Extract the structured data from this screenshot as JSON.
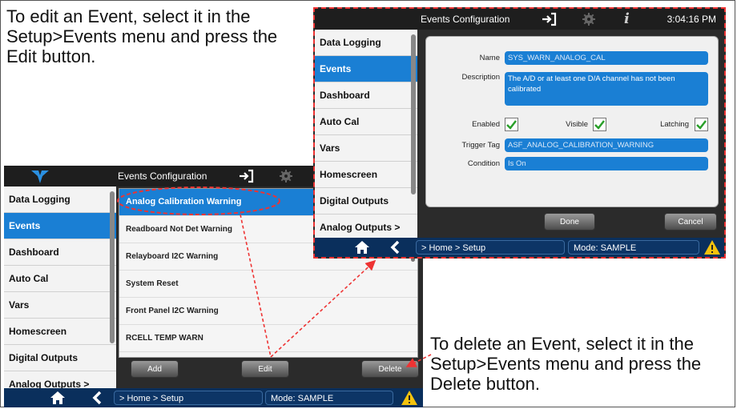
{
  "notes": {
    "edit": "To edit an Event, select it in the Setup>Events menu and press the Edit button.",
    "delete": "To delete an Event, select it in the Setup>Events menu and press the Delete button."
  },
  "list_screen": {
    "title": "Events Configuration",
    "sidebar": [
      "Data Logging",
      "Events",
      "Dashboard",
      "Auto Cal",
      "Vars",
      "Homescreen",
      "Digital Outputs",
      "Analog Outputs >"
    ],
    "active_sidebar": "Events",
    "events": [
      "Analog Calibration Warning",
      "Readboard Not Det Warning",
      "Relayboard I2C Warning",
      "System Reset",
      "Front Panel I2C Warning",
      "RCELL TEMP WARN"
    ],
    "selected_event": "Analog Calibration Warning",
    "buttons": {
      "add": "Add",
      "edit": "Edit",
      "delete": "Delete"
    },
    "breadcrumb": "> Home > Setup",
    "mode": "Mode: SAMPLE"
  },
  "detail_screen": {
    "title": "Events Configuration",
    "time": "3:04:16 PM",
    "sidebar": [
      "Data Logging",
      "Events",
      "Dashboard",
      "Auto Cal",
      "Vars",
      "Homescreen",
      "Digital Outputs",
      "Analog Outputs >"
    ],
    "active_sidebar": "Events",
    "labels": {
      "name": "Name",
      "description": "Description",
      "enabled": "Enabled",
      "visible": "Visible",
      "latching": "Latching",
      "trigger_tag": "Trigger Tag",
      "condition": "Condition"
    },
    "values": {
      "name": "SYS_WARN_ANALOG_CAL",
      "description": "The A/D or at least one D/A channel has not been calibrated",
      "enabled": true,
      "visible": true,
      "latching": true,
      "trigger_tag": "ASF_ANALOG_CALIBRATION_WARNING",
      "condition": "Is On"
    },
    "buttons": {
      "done": "Done",
      "cancel": "Cancel"
    },
    "breadcrumb": "> Home > Setup",
    "mode": "Mode: SAMPLE"
  },
  "colors": {
    "accent": "#1a7fd4",
    "bottom_bar": "#0a2f5c",
    "callout": "#e33333",
    "warning": "#f4c20d"
  }
}
